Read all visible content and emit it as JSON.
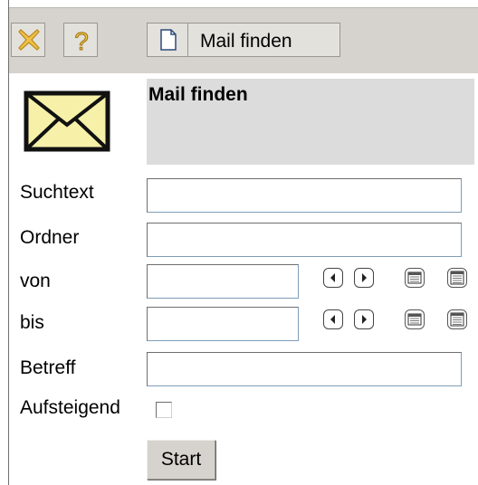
{
  "toolbar": {
    "close_icon": "close-icon",
    "help_icon": "help-icon",
    "mail_button_label": "Mail finden"
  },
  "header": {
    "title": "Mail finden",
    "icon": "envelope-icon"
  },
  "form": {
    "suchtext_label": "Suchtext",
    "ordner_label": "Ordner",
    "von_label": "von",
    "bis_label": "bis",
    "betreff_label": "Betreff",
    "aufsteigend_label": "Aufsteigend",
    "suchtext_value": "",
    "ordner_value": "",
    "von_value": "",
    "bis_value": "",
    "betreff_value": "",
    "aufsteigend_checked": false,
    "start_label": "Start"
  },
  "colors": {
    "toolbar_bg": "#d6d3ce",
    "title_bg": "#dcdcdc",
    "icon_yellow": "#f2c14a",
    "envelope_fill": "#f7f0a8"
  }
}
